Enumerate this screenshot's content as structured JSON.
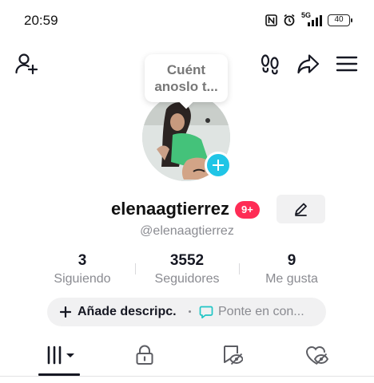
{
  "status_bar": {
    "time": "20:59",
    "network": "5G",
    "battery": "40",
    "icons": [
      "nfc-icon",
      "alarm-icon",
      "signal-icon",
      "battery-icon"
    ]
  },
  "header": {
    "icons": [
      "add-friend-icon",
      "footprints-icon",
      "share-icon",
      "menu-icon"
    ],
    "tooltip": {
      "line1": "Cuént",
      "line2": "anoslo t..."
    }
  },
  "profile": {
    "username": "elenaagtierrez",
    "notification_badge": "9+",
    "handle": "@elenaagtierrez",
    "avatar_accent": "#20c5e6"
  },
  "stats": [
    {
      "value": "3",
      "label": "Siguiendo"
    },
    {
      "value": "3552",
      "label": "Seguidores"
    },
    {
      "value": "9",
      "label": "Me gusta"
    }
  ],
  "actions": {
    "add_description": "Añade descripc.",
    "contact": "Ponte en con..."
  },
  "tabs": [
    {
      "name": "videos",
      "icon": "grid-icon",
      "active": true
    },
    {
      "name": "private",
      "icon": "lock-icon",
      "active": false
    },
    {
      "name": "reposts",
      "icon": "hidden-reposts-icon",
      "active": false
    },
    {
      "name": "liked",
      "icon": "hidden-heart-icon",
      "active": false
    }
  ],
  "colors": {
    "badge": "#fe2c55",
    "accent": "#20c5e6",
    "text": "#161823",
    "muted": "#8a8b91"
  }
}
